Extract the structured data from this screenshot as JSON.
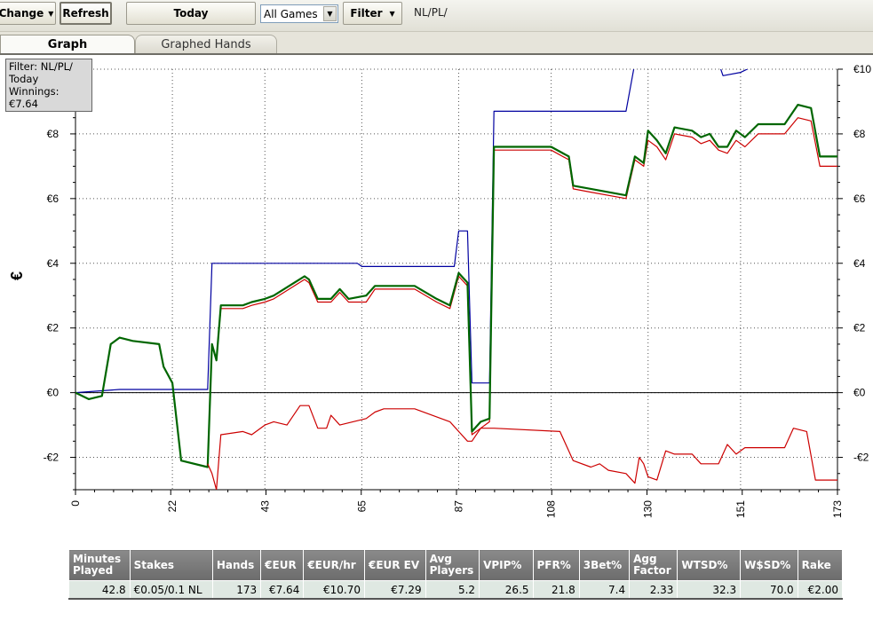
{
  "toolbar": {
    "change_label": "Change",
    "refresh_label": "Refresh",
    "today_label": "Today",
    "games_select": "All Games",
    "filter_label": "Filter",
    "filter_text": "NL/PL/"
  },
  "tabs": [
    {
      "label": "Graph",
      "active": true
    },
    {
      "label": "Graphed Hands",
      "active": false
    }
  ],
  "tooltip": {
    "line1": "Filter: NL/PL/",
    "line2": "Today",
    "line3": "Winnings: €7.64"
  },
  "chart_data": {
    "type": "line",
    "ylabel": "€",
    "xlim": [
      0,
      173
    ],
    "ylim": [
      -3,
      10
    ],
    "x_ticks": [
      0,
      22,
      43,
      65,
      87,
      108,
      130,
      151,
      173
    ],
    "y_ticks": [
      {
        "value": -2,
        "label": "-€2"
      },
      {
        "value": 0,
        "label": "€0"
      },
      {
        "value": 2,
        "label": "€2"
      },
      {
        "value": 4,
        "label": "€4"
      },
      {
        "value": 6,
        "label": "€6"
      },
      {
        "value": 8,
        "label": "€8"
      },
      {
        "value": 10,
        "label": "€10"
      }
    ],
    "grid": true,
    "series": [
      {
        "color": "#0000a0",
        "points": [
          [
            0,
            0
          ],
          [
            10,
            0.1
          ],
          [
            30,
            0.1
          ],
          [
            31,
            4
          ],
          [
            64,
            4
          ],
          [
            65,
            3.9
          ],
          [
            86,
            3.9
          ],
          [
            87,
            5
          ],
          [
            89,
            5
          ],
          [
            90,
            0.3
          ],
          [
            94,
            0.3
          ],
          [
            95,
            8.7
          ],
          [
            125,
            8.7
          ],
          [
            127,
            10.2
          ],
          [
            146,
            10.2
          ],
          [
            147,
            9.8
          ],
          [
            151,
            9.9
          ],
          [
            154,
            10.1
          ],
          [
            173,
            10.1
          ]
        ]
      },
      {
        "color": "#cc0000",
        "points": [
          [
            0,
            0
          ],
          [
            3,
            -0.2
          ],
          [
            6,
            -0.1
          ],
          [
            8,
            1.5
          ],
          [
            10,
            1.7
          ],
          [
            13,
            1.6
          ],
          [
            19,
            1.5
          ],
          [
            20,
            0.8
          ],
          [
            22,
            0.3
          ],
          [
            24,
            -2.1
          ],
          [
            30,
            -2.3
          ],
          [
            31,
            1.5
          ],
          [
            32,
            1
          ],
          [
            33,
            2.6
          ],
          [
            38,
            2.6
          ],
          [
            40,
            2.7
          ],
          [
            43,
            2.8
          ],
          [
            45,
            2.9
          ],
          [
            52,
            3.5
          ],
          [
            53,
            3.4
          ],
          [
            55,
            2.8
          ],
          [
            58,
            2.8
          ],
          [
            60,
            3.1
          ],
          [
            62,
            2.8
          ],
          [
            66,
            2.8
          ],
          [
            68,
            3.2
          ],
          [
            77,
            3.2
          ],
          [
            82,
            2.8
          ],
          [
            85,
            2.6
          ],
          [
            87,
            3.6
          ],
          [
            89,
            3.3
          ],
          [
            90,
            -1.3
          ],
          [
            92,
            -1.1
          ],
          [
            94,
            -0.9
          ],
          [
            95,
            7.5
          ],
          [
            108,
            7.5
          ],
          [
            112,
            7.2
          ],
          [
            113,
            6.3
          ],
          [
            117,
            6.2
          ],
          [
            125,
            6
          ],
          [
            127,
            7.2
          ],
          [
            129,
            7
          ],
          [
            130,
            7.8
          ],
          [
            132,
            7.6
          ],
          [
            134,
            7.2
          ],
          [
            136,
            8
          ],
          [
            140,
            7.9
          ],
          [
            142,
            7.7
          ],
          [
            144,
            7.8
          ],
          [
            146,
            7.5
          ],
          [
            148,
            7.4
          ],
          [
            150,
            7.8
          ],
          [
            152,
            7.6
          ],
          [
            155,
            8
          ],
          [
            161,
            8
          ],
          [
            164,
            8.5
          ],
          [
            167,
            8.4
          ],
          [
            169,
            7
          ],
          [
            173,
            7
          ]
        ]
      },
      {
        "color": "#006600",
        "points": [
          [
            0,
            0
          ],
          [
            3,
            -0.2
          ],
          [
            6,
            -0.1
          ],
          [
            8,
            1.5
          ],
          [
            10,
            1.7
          ],
          [
            13,
            1.6
          ],
          [
            19,
            1.5
          ],
          [
            20,
            0.8
          ],
          [
            22,
            0.3
          ],
          [
            24,
            -2.1
          ],
          [
            30,
            -2.3
          ],
          [
            31,
            1.5
          ],
          [
            32,
            1
          ],
          [
            33,
            2.7
          ],
          [
            38,
            2.7
          ],
          [
            40,
            2.8
          ],
          [
            43,
            2.9
          ],
          [
            45,
            3
          ],
          [
            52,
            3.6
          ],
          [
            53,
            3.5
          ],
          [
            55,
            2.9
          ],
          [
            58,
            2.9
          ],
          [
            60,
            3.2
          ],
          [
            62,
            2.9
          ],
          [
            66,
            3
          ],
          [
            68,
            3.3
          ],
          [
            77,
            3.3
          ],
          [
            82,
            2.9
          ],
          [
            85,
            2.7
          ],
          [
            87,
            3.7
          ],
          [
            89,
            3.4
          ],
          [
            90,
            -1.2
          ],
          [
            92,
            -0.9
          ],
          [
            94,
            -0.8
          ],
          [
            95,
            7.6
          ],
          [
            108,
            7.6
          ],
          [
            112,
            7.3
          ],
          [
            113,
            6.4
          ],
          [
            117,
            6.3
          ],
          [
            125,
            6.1
          ],
          [
            127,
            7.3
          ],
          [
            129,
            7.1
          ],
          [
            130,
            8.1
          ],
          [
            132,
            7.8
          ],
          [
            134,
            7.4
          ],
          [
            136,
            8.2
          ],
          [
            140,
            8.1
          ],
          [
            142,
            7.9
          ],
          [
            144,
            8.0
          ],
          [
            146,
            7.6
          ],
          [
            148,
            7.6
          ],
          [
            150,
            8.1
          ],
          [
            152,
            7.9
          ],
          [
            155,
            8.3
          ],
          [
            161,
            8.3
          ],
          [
            164,
            8.9
          ],
          [
            167,
            8.8
          ],
          [
            169,
            7.3
          ],
          [
            173,
            7.3
          ]
        ]
      },
      {
        "color": "#cc0000",
        "points": [
          [
            30,
            -2.2
          ],
          [
            31,
            -2.5
          ],
          [
            32,
            -3
          ],
          [
            33,
            -1.3
          ],
          [
            38,
            -1.2
          ],
          [
            40,
            -1.3
          ],
          [
            43,
            -1
          ],
          [
            45,
            -0.9
          ],
          [
            48,
            -1
          ],
          [
            51,
            -0.4
          ],
          [
            53,
            -0.4
          ],
          [
            55,
            -1.1
          ],
          [
            57,
            -1.1
          ],
          [
            58,
            -0.7
          ],
          [
            60,
            -1
          ],
          [
            66,
            -0.8
          ],
          [
            68,
            -0.6
          ],
          [
            70,
            -0.5
          ],
          [
            77,
            -0.5
          ],
          [
            85,
            -0.9
          ],
          [
            87,
            -1.2
          ],
          [
            89,
            -1.5
          ],
          [
            90,
            -1.5
          ],
          [
            92,
            -1.1
          ],
          [
            95,
            -1.1
          ],
          [
            110,
            -1.2
          ],
          [
            113,
            -2.1
          ],
          [
            117,
            -2.3
          ],
          [
            119,
            -2.2
          ],
          [
            121,
            -2.4
          ],
          [
            125,
            -2.5
          ],
          [
            127,
            -2.8
          ],
          [
            128,
            -2
          ],
          [
            129,
            -2.2
          ],
          [
            130,
            -2.6
          ],
          [
            132,
            -2.7
          ],
          [
            134,
            -1.8
          ],
          [
            136,
            -1.9
          ],
          [
            140,
            -1.9
          ],
          [
            142,
            -2.2
          ],
          [
            146,
            -2.2
          ],
          [
            148,
            -1.6
          ],
          [
            150,
            -1.9
          ],
          [
            152,
            -1.7
          ],
          [
            155,
            -1.7
          ],
          [
            161,
            -1.7
          ],
          [
            163,
            -1.1
          ],
          [
            166,
            -1.2
          ],
          [
            168,
            -2.7
          ],
          [
            173,
            -2.7
          ]
        ]
      }
    ],
    "zero_line": true
  },
  "stats_table": {
    "headers": [
      "Minutes Played",
      "Stakes",
      "Hands",
      "€EUR",
      "€EUR/hr",
      "€EUR EV",
      "Avg Players",
      "VPIP%",
      "PFR%",
      "3Bet%",
      "Agg Factor",
      "WTSD%",
      "W$SD%",
      "Rake"
    ],
    "row": [
      "42.8",
      "€0.05/0.1 NL",
      "173",
      "€7.64",
      "€10.70",
      "€7.29",
      "5.2",
      "26.5",
      "21.8",
      "7.4",
      "2.33",
      "32.3",
      "70.0",
      "€2.00"
    ]
  }
}
